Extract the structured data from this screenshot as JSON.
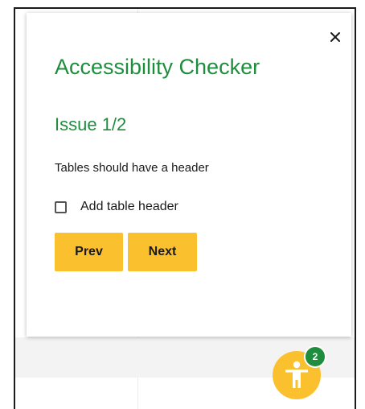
{
  "panel": {
    "title": "Accessibility Checker",
    "close_icon": "close-icon"
  },
  "issue": {
    "heading": "Issue 1/2",
    "description": "Tables should have a header"
  },
  "fix": {
    "label": "Add table header",
    "checked": false
  },
  "nav": {
    "prev_label": "Prev",
    "next_label": "Next"
  },
  "launcher": {
    "icon": "accessibility-person-icon",
    "badge_count": "2"
  },
  "colors": {
    "accent_green": "#1e8e3e",
    "button_yellow": "#fbc02d"
  }
}
